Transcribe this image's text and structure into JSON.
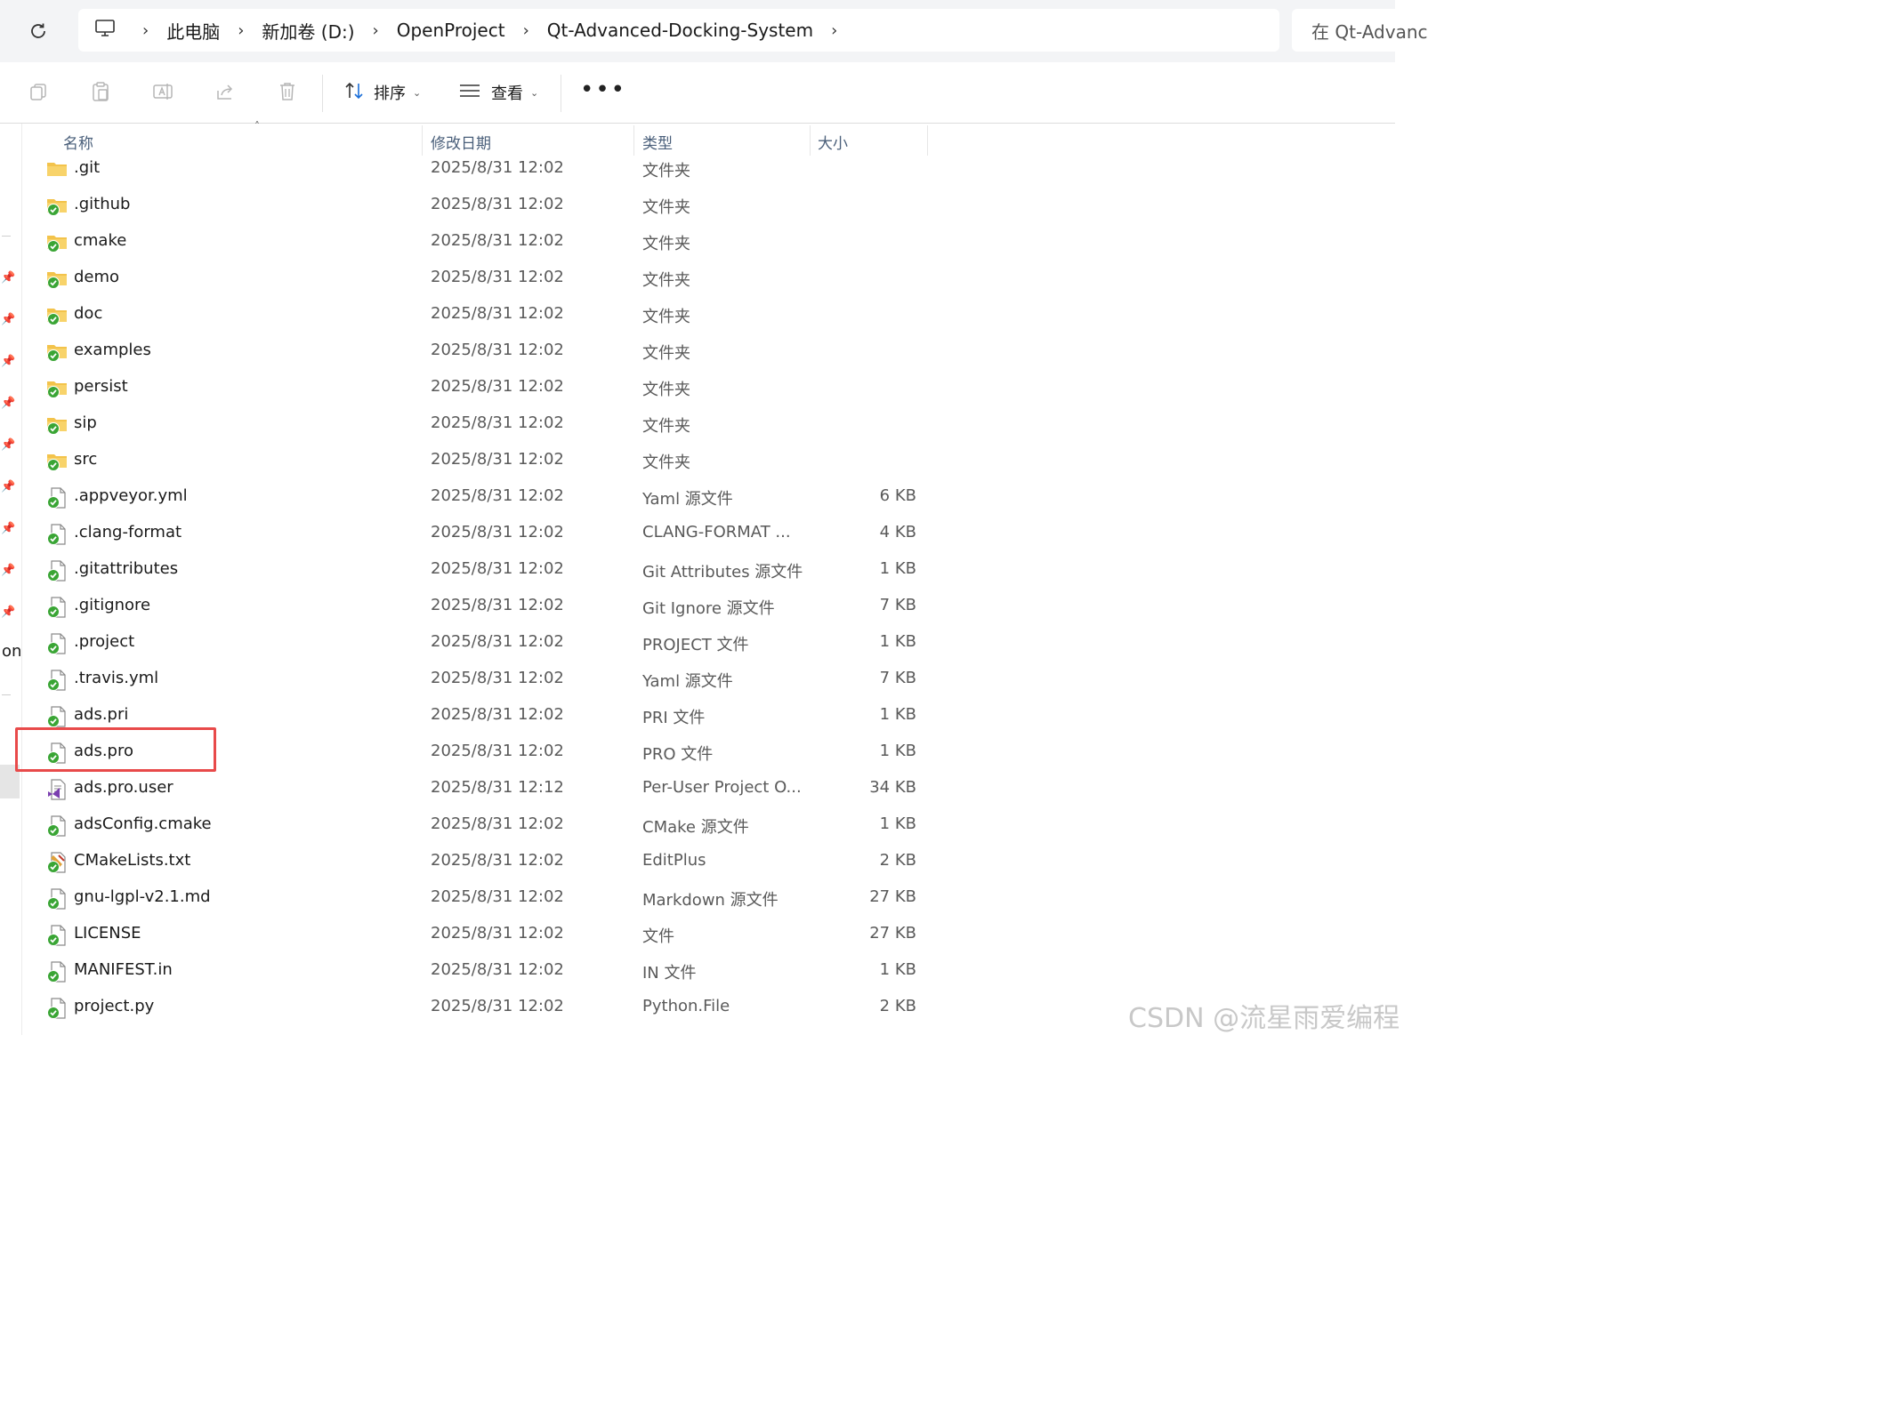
{
  "address": {
    "crumbs": [
      "此电脑",
      "新加卷 (D:)",
      "OpenProject",
      "Qt-Advanced-Docking-System"
    ],
    "search_placeholder": "在 Qt-Advanced-Docking-System 中搜索"
  },
  "toolbar": {
    "sort_label": "排序",
    "view_label": "查看",
    "more_label": "•••"
  },
  "sidebar": {
    "partial_text": "on"
  },
  "columns": {
    "name": "名称",
    "date": "修改日期",
    "type": "类型",
    "size": "大小"
  },
  "files": [
    {
      "name": ".git",
      "date": "2025/8/31 12:02",
      "type": "文件夹",
      "size": "",
      "icon": "folder-icon"
    },
    {
      "name": ".github",
      "date": "2025/8/31 12:02",
      "type": "文件夹",
      "size": "",
      "icon": "folder-synced-icon"
    },
    {
      "name": "cmake",
      "date": "2025/8/31 12:02",
      "type": "文件夹",
      "size": "",
      "icon": "folder-synced-icon"
    },
    {
      "name": "demo",
      "date": "2025/8/31 12:02",
      "type": "文件夹",
      "size": "",
      "icon": "folder-synced-icon"
    },
    {
      "name": "doc",
      "date": "2025/8/31 12:02",
      "type": "文件夹",
      "size": "",
      "icon": "folder-synced-icon"
    },
    {
      "name": "examples",
      "date": "2025/8/31 12:02",
      "type": "文件夹",
      "size": "",
      "icon": "folder-synced-icon"
    },
    {
      "name": "persist",
      "date": "2025/8/31 12:02",
      "type": "文件夹",
      "size": "",
      "icon": "folder-synced-icon"
    },
    {
      "name": "sip",
      "date": "2025/8/31 12:02",
      "type": "文件夹",
      "size": "",
      "icon": "folder-synced-icon"
    },
    {
      "name": "src",
      "date": "2025/8/31 12:02",
      "type": "文件夹",
      "size": "",
      "icon": "folder-synced-icon"
    },
    {
      "name": ".appveyor.yml",
      "date": "2025/8/31 12:02",
      "type": "Yaml 源文件",
      "size": "6 KB",
      "icon": "file-synced-icon"
    },
    {
      "name": ".clang-format",
      "date": "2025/8/31 12:02",
      "type": "CLANG-FORMAT ...",
      "size": "4 KB",
      "icon": "file-synced-icon"
    },
    {
      "name": ".gitattributes",
      "date": "2025/8/31 12:02",
      "type": "Git Attributes 源文件",
      "size": "1 KB",
      "icon": "file-synced-icon"
    },
    {
      "name": ".gitignore",
      "date": "2025/8/31 12:02",
      "type": "Git Ignore 源文件",
      "size": "7 KB",
      "icon": "file-synced-icon"
    },
    {
      "name": ".project",
      "date": "2025/8/31 12:02",
      "type": "PROJECT 文件",
      "size": "1 KB",
      "icon": "file-synced-icon"
    },
    {
      "name": ".travis.yml",
      "date": "2025/8/31 12:02",
      "type": "Yaml 源文件",
      "size": "7 KB",
      "icon": "file-synced-icon"
    },
    {
      "name": "ads.pri",
      "date": "2025/8/31 12:02",
      "type": "PRI 文件",
      "size": "1 KB",
      "icon": "file-synced-icon"
    },
    {
      "name": "ads.pro",
      "date": "2025/8/31 12:02",
      "type": "PRO 文件",
      "size": "1 KB",
      "icon": "file-synced-icon"
    },
    {
      "name": "ads.pro.user",
      "date": "2025/8/31 12:12",
      "type": "Per-User Project O...",
      "size": "34 KB",
      "icon": "visual-studio-file-icon"
    },
    {
      "name": "adsConfig.cmake",
      "date": "2025/8/31 12:02",
      "type": "CMake 源文件",
      "size": "1 KB",
      "icon": "file-synced-icon"
    },
    {
      "name": "CMakeLists.txt",
      "date": "2025/8/31 12:02",
      "type": "EditPlus",
      "size": "2 KB",
      "icon": "editplus-file-icon"
    },
    {
      "name": "gnu-lgpl-v2.1.md",
      "date": "2025/8/31 12:02",
      "type": "Markdown 源文件",
      "size": "27 KB",
      "icon": "file-synced-icon"
    },
    {
      "name": "LICENSE",
      "date": "2025/8/31 12:02",
      "type": "文件",
      "size": "27 KB",
      "icon": "file-synced-icon"
    },
    {
      "name": "MANIFEST.in",
      "date": "2025/8/31 12:02",
      "type": "IN 文件",
      "size": "1 KB",
      "icon": "file-synced-icon"
    },
    {
      "name": "project.py",
      "date": "2025/8/31 12:02",
      "type": "Python.File",
      "size": "2 KB",
      "icon": "file-synced-icon"
    }
  ],
  "highlighted_file": "ads.pro",
  "watermark": "CSDN @流星雨爱编程",
  "colors": {
    "highlight_border": "#e84a4a",
    "folder": "#f3c34b",
    "sync_badge": "#3aa535",
    "header_text": "#4a5f7a"
  }
}
